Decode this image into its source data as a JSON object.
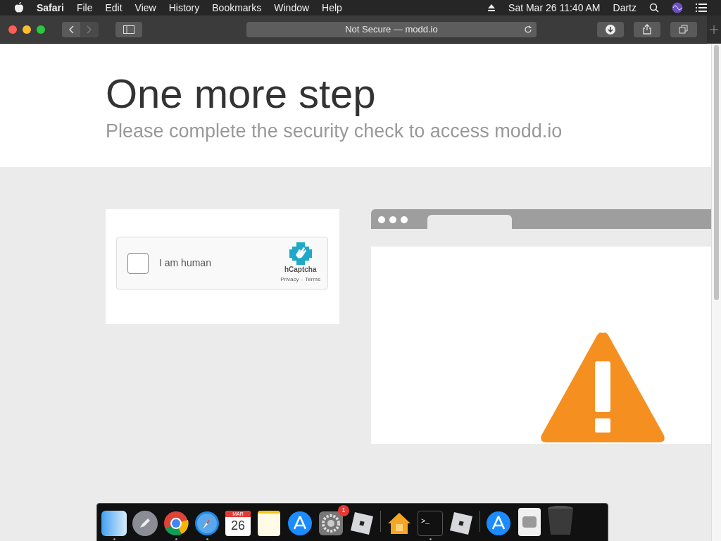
{
  "menubar": {
    "app": "Safari",
    "menus": [
      "File",
      "Edit",
      "View",
      "History",
      "Bookmarks",
      "Window",
      "Help"
    ],
    "date": "Sat Mar 26",
    "time": "11:40 AM",
    "user": "Dartz"
  },
  "toolbar": {
    "address": "Not Secure — modd.io"
  },
  "page": {
    "title": "One more step",
    "subtitle": "Please complete the security check to access modd.io",
    "captcha": {
      "label": "I am human",
      "checked": false,
      "brand": "hCaptcha",
      "links": [
        "Privacy",
        "Terms"
      ],
      "separator": "-"
    }
  },
  "dock": [
    {
      "kind": "finder",
      "running": true
    },
    {
      "kind": "launchpad",
      "running": false
    },
    {
      "kind": "chrome",
      "running": true
    },
    {
      "kind": "safari",
      "running": true
    },
    {
      "kind": "calendar",
      "running": false,
      "month": "MAR",
      "day": "26"
    },
    {
      "kind": "notes",
      "running": false
    },
    {
      "kind": "appstore",
      "running": false
    },
    {
      "kind": "settings",
      "running": false,
      "badge": "1"
    },
    {
      "kind": "roblox",
      "running": false
    },
    {
      "kind": "divider"
    },
    {
      "kind": "home",
      "running": false
    },
    {
      "kind": "terminal",
      "running": true,
      "prompt": ">_"
    },
    {
      "kind": "roblox",
      "running": false
    },
    {
      "kind": "divider"
    },
    {
      "kind": "appstore",
      "running": false
    },
    {
      "kind": "disk",
      "running": false
    },
    {
      "kind": "trash",
      "running": false
    }
  ]
}
